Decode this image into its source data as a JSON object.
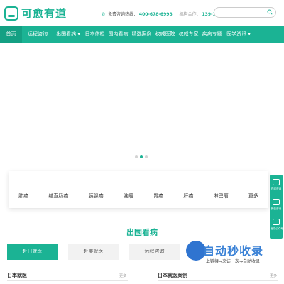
{
  "header": {
    "logo_text": "可愈有道",
    "slogan": "",
    "hotline_label": "免费咨询热线：",
    "hotline_number": "400-678-6998",
    "mobile_label": "机构合作：",
    "mobile_number": "139-1122-6078",
    "search_placeholder": ""
  },
  "nav": {
    "items": [
      {
        "label": "首页"
      },
      {
        "label": "远程咨询"
      },
      {
        "label": "出国看病 ▾"
      },
      {
        "label": "日本体检"
      },
      {
        "label": "国内看病"
      },
      {
        "label": "精选案例"
      },
      {
        "label": "权威医院"
      },
      {
        "label": "权威专家"
      },
      {
        "label": "疾病专题"
      },
      {
        "label": "医学资讯 ▾"
      }
    ]
  },
  "categories": [
    "肺癌",
    "结直肠癌",
    "胰腺癌",
    "脑瘤",
    "胃癌",
    "肝癌",
    "淋巴瘤",
    "更多"
  ],
  "side": {
    "items": [
      "在线咨询",
      "微信咨询",
      "官方公众号"
    ]
  },
  "section": {
    "title": "出国看病",
    "tabs": [
      "赴日就医",
      "赴美就医",
      "远程咨询"
    ]
  },
  "lists": {
    "left_title": "日本就医",
    "right_title": "日本就医案例",
    "more": "更多"
  },
  "watermark": {
    "text": "自动秒收录",
    "sub": "上链接→来访一次→自动收录"
  },
  "colors": {
    "accent": "#1bb394",
    "accent_dark": "#14a083",
    "tab_bg": "#f2f2f2"
  }
}
